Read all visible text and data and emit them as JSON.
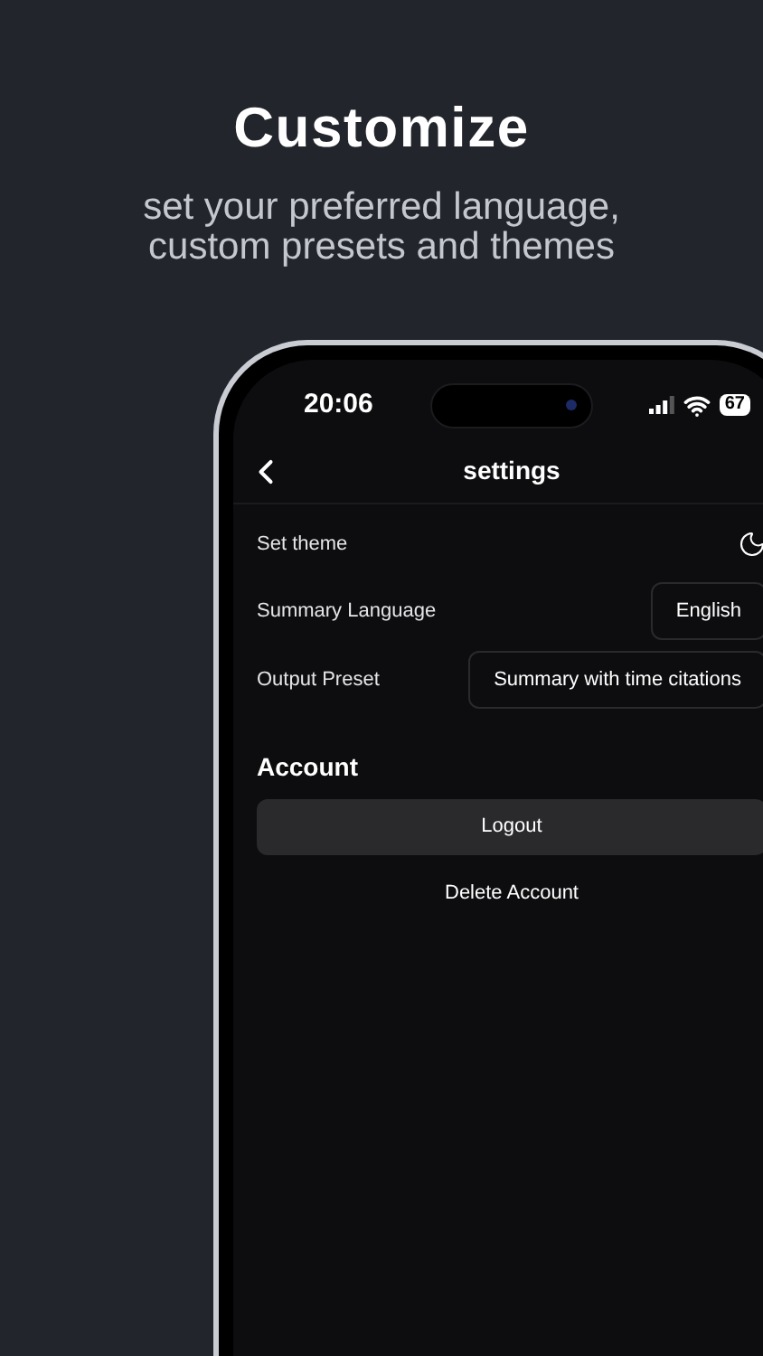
{
  "headline": {
    "title": "Customize",
    "subtitle": "set your preferred language, custom presets and themes"
  },
  "status_bar": {
    "time": "20:06",
    "battery": "67"
  },
  "nav": {
    "title": "settings"
  },
  "settings": [
    {
      "kind": "icon",
      "label": "Set theme"
    },
    {
      "kind": "select",
      "label": "Summary Language",
      "value": "English"
    },
    {
      "kind": "select",
      "label": "Output Preset",
      "value": "Summary with time citations"
    }
  ],
  "account": {
    "heading": "Account",
    "buttons": [
      {
        "kind": "filled",
        "label": "Logout"
      },
      {
        "kind": "plain",
        "label": "Delete Account"
      }
    ]
  }
}
